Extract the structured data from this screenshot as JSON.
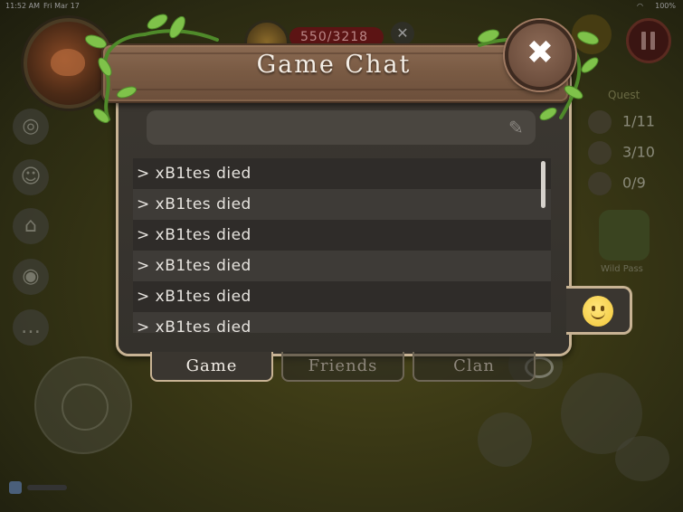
{
  "status_bar": {
    "time": "11:52 AM",
    "date": "Fri Mar 17",
    "battery": "100%"
  },
  "hud": {
    "hp_text": "550/3218",
    "quest_label": "Quest",
    "quests": [
      "1/11",
      "3/10",
      "0/9"
    ],
    "wild_pass_label": "Wild Pass"
  },
  "chat": {
    "title": "Game Chat",
    "input_placeholder": "",
    "messages": [
      "> xB1tes died",
      "> xB1tes died",
      "> xB1tes died",
      "> xB1tes died",
      "> xB1tes died",
      "> xB1tes died"
    ],
    "tabs": [
      {
        "label": "Game",
        "active": true
      },
      {
        "label": "Friends",
        "active": false
      },
      {
        "label": "Clan",
        "active": false
      }
    ],
    "emoji_icon": "slightly-smiling-face-icon",
    "colors": {
      "panel": "#3a3630",
      "border": "#c8b394",
      "banner": "#7a5b44"
    }
  }
}
